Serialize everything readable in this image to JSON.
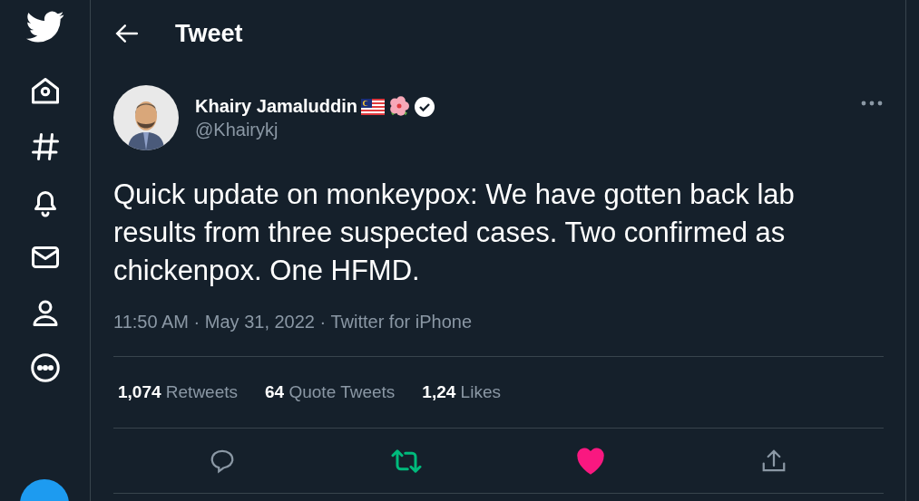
{
  "header": {
    "title": "Tweet"
  },
  "tweet": {
    "name": "Khairy Jamaluddin",
    "handle": "@Khairykj",
    "verified": true,
    "text": "Quick update on monkeypox: We have gotten back lab results from three suspected cases. Two confirmed as chickenpox. One HFMD.",
    "meta": "11:50 AM · May 31, 2022 · Twitter for iPhone",
    "stats": [
      {
        "count": "1,074",
        "label": "Retweets"
      },
      {
        "count": "64",
        "label": "Quote Tweets"
      },
      {
        "count": "1,24",
        "label": "Likes"
      }
    ],
    "retweeted": true,
    "liked": true
  }
}
